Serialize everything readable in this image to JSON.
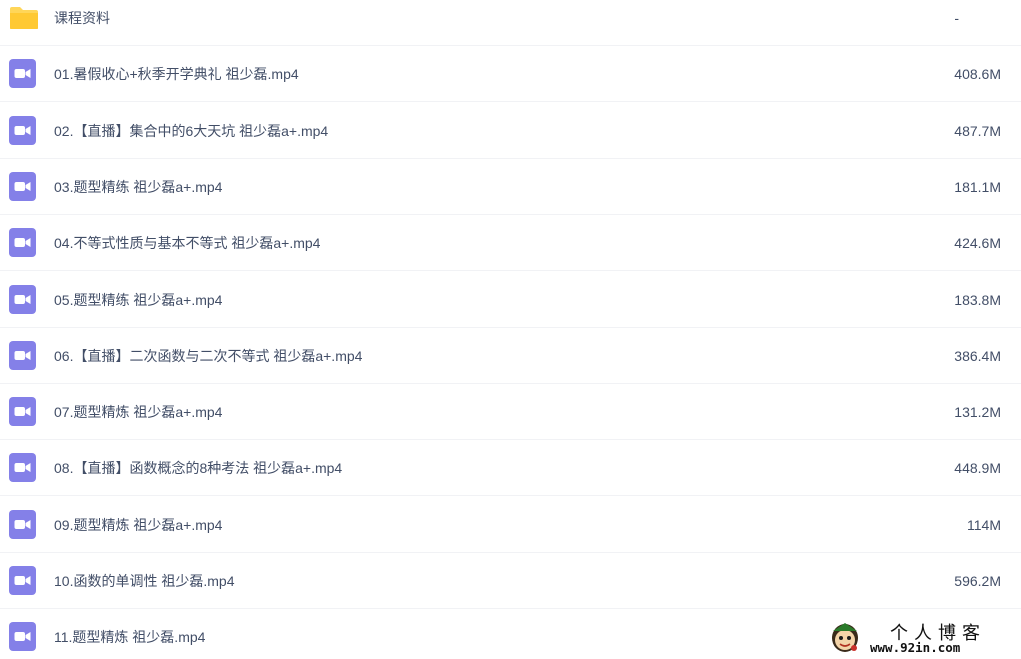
{
  "files": [
    {
      "name": "课程资料",
      "size": "-",
      "type": "folder"
    },
    {
      "name": "01.暑假收心+秋季开学典礼 祖少磊.mp4",
      "size": "408.6M",
      "type": "video"
    },
    {
      "name": "02.【直播】集合中的6大天坑 祖少磊a+.mp4",
      "size": "487.7M",
      "type": "video"
    },
    {
      "name": "03.题型精练 祖少磊a+.mp4",
      "size": "181.1M",
      "type": "video"
    },
    {
      "name": "04.不等式性质与基本不等式 祖少磊a+.mp4",
      "size": "424.6M",
      "type": "video"
    },
    {
      "name": "05.题型精练 祖少磊a+.mp4",
      "size": "183.8M",
      "type": "video"
    },
    {
      "name": "06.【直播】二次函数与二次不等式 祖少磊a+.mp4",
      "size": "386.4M",
      "type": "video"
    },
    {
      "name": "07.题型精炼 祖少磊a+.mp4",
      "size": "131.2M",
      "type": "video"
    },
    {
      "name": "08.【直播】函数概念的8种考法 祖少磊a+.mp4",
      "size": "448.9M",
      "type": "video"
    },
    {
      "name": "09.题型精炼 祖少磊a+.mp4",
      "size": "114M",
      "type": "video"
    },
    {
      "name": "10.函数的单调性 祖少磊.mp4",
      "size": "596.2M",
      "type": "video"
    },
    {
      "name": "11.题型精炼 祖少磊.mp4",
      "size": "",
      "type": "video"
    }
  ],
  "watermark": {
    "title": "个人博客",
    "url": "www.92in.com"
  },
  "colors": {
    "text": "#424e67",
    "folder": "#ffd659",
    "video": "#8480e8",
    "divider": "#f1f2f5"
  },
  "icons": {
    "folder": "folder-icon",
    "video": "video-file-icon"
  }
}
